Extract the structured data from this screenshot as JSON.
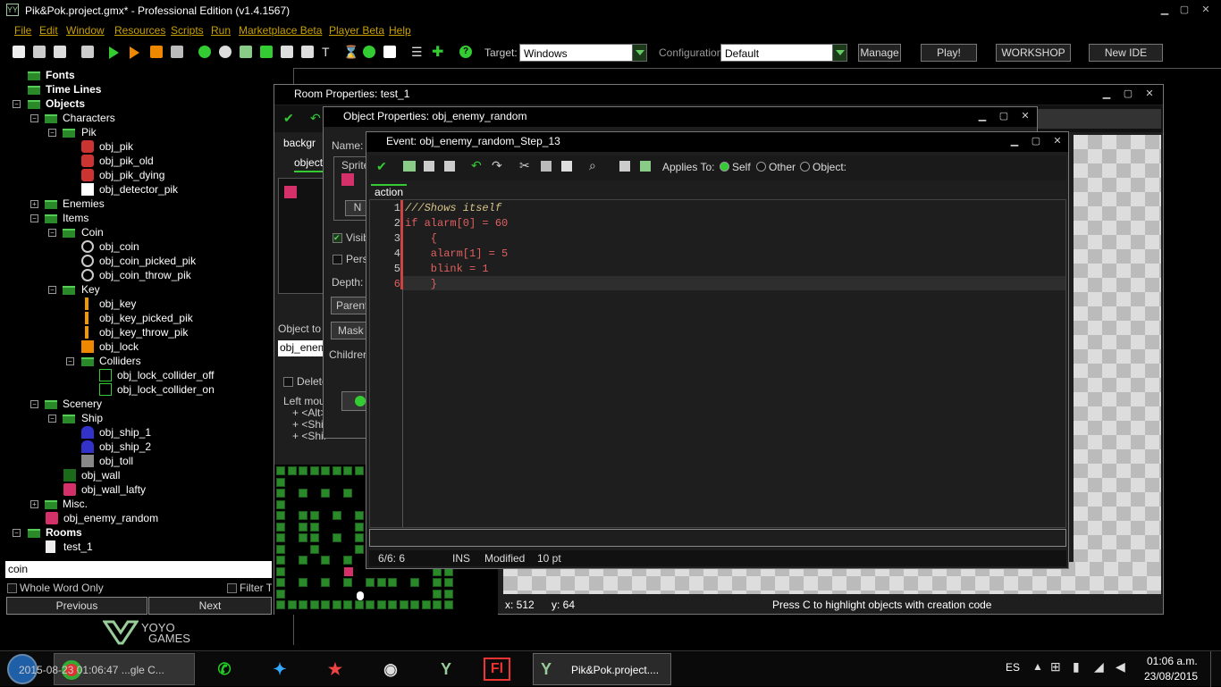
{
  "window": {
    "title": "Pik&Pok.project.gmx*  -  Professional Edition (v1.4.1567)"
  },
  "menu": [
    "File",
    "Edit",
    "Window",
    "Resources",
    "Scripts",
    "Run",
    "Marketplace Beta",
    "Player Beta",
    "Help"
  ],
  "toolbar": {
    "target_label": "Target:",
    "target_value": "Windows",
    "config_label": "Configuration:",
    "config_value": "Default",
    "manage": "Manage",
    "play": "Play!",
    "workshop": "WORKSHOP",
    "new_ide": "New IDE"
  },
  "tree": {
    "fonts": "Fonts",
    "timelines": "Time Lines",
    "objects": "Objects",
    "characters": "Characters",
    "pik": "Pik",
    "obj_pik": "obj_pik",
    "obj_pik_old": "obj_pik_old",
    "obj_pik_dying": "obj_pik_dying",
    "obj_detector_pik": "obj_detector_pik",
    "enemies": "Enemies",
    "items": "Items",
    "coin": "Coin",
    "obj_coin": "obj_coin",
    "obj_coin_picked_pik": "obj_coin_picked_pik",
    "obj_coin_throw_pik": "obj_coin_throw_pik",
    "key": "Key",
    "obj_key": "obj_key",
    "obj_key_picked_pik": "obj_key_picked_pik",
    "obj_key_throw_pik": "obj_key_throw_pik",
    "obj_lock": "obj_lock",
    "colliders": "Colliders",
    "obj_lock_collider_off": "obj_lock_collider_off",
    "obj_lock_collider_on": "obj_lock_collider_on",
    "scenery": "Scenery",
    "ship": "Ship",
    "obj_ship_1": "obj_ship_1",
    "obj_ship_2": "obj_ship_2",
    "obj_toll": "obj_toll",
    "obj_wall": "obj_wall",
    "obj_wall_lafty": "obj_wall_lafty",
    "misc": "Misc.",
    "obj_enemy_random": "obj_enemy_random",
    "rooms": "Rooms",
    "test_1": "test_1"
  },
  "search": {
    "value": "coin",
    "whole_word": "Whole Word Only",
    "filter": "Filter Tr",
    "previous": "Previous",
    "next": "Next"
  },
  "brand": {
    "line1": "YOYO",
    "line2": "GAMES"
  },
  "room": {
    "title": "Room Properties: test_1",
    "tab1": "backgr",
    "tab2": "object",
    "object_to_add": "Object to a",
    "object_field": "obj_enem",
    "delete": "Delete",
    "left_mouse": "Left mou",
    "alt": "+ <Alt>",
    "shift1": "+ <Shif",
    "shift2": "+ <Shif",
    "coords_x": "x: 512",
    "coords_y": "y: 64",
    "hint": "Press C to highlight objects with creation code"
  },
  "object": {
    "title": "Object Properties: obj_enemy_random",
    "name": "Name:",
    "sprite": "Sprite",
    "visible": "Visib",
    "persistent": "Pers",
    "depth": "Depth:",
    "parent": "Parent",
    "mask": "Mask",
    "children": "Children",
    "btn_n": "N"
  },
  "event": {
    "title": "Event: obj_enemy_random_Step_13",
    "applies_to": "Applies To:",
    "self": "Self",
    "other": "Other",
    "object": "Object:",
    "tab": "action",
    "code": [
      {
        "n": "1",
        "text": "///Shows itself"
      },
      {
        "n": "2",
        "text": "if alarm[0] = 60"
      },
      {
        "n": "3",
        "text": "    {"
      },
      {
        "n": "4",
        "text": "    alarm[1] = 5"
      },
      {
        "n": "5",
        "text": "    blink = 1"
      },
      {
        "n": "6",
        "text": "    }"
      }
    ],
    "status": {
      "pos": "6/6:  6",
      "mode": "INS",
      "state": "Modified",
      "size": "10 pt"
    }
  },
  "taskbar": {
    "chrome_item": "2015-08-23 01:06:47 ...gle C...",
    "gm_item": "Pik&Pok.project....",
    "lang": "ES",
    "time": "01:06 a.m.",
    "date": "23/08/2015"
  },
  "colors": {
    "accent_green": "#2a8a2a",
    "menu_gold": "#c8a000",
    "comment": "#d9c38a",
    "keyword": "#e06060"
  }
}
